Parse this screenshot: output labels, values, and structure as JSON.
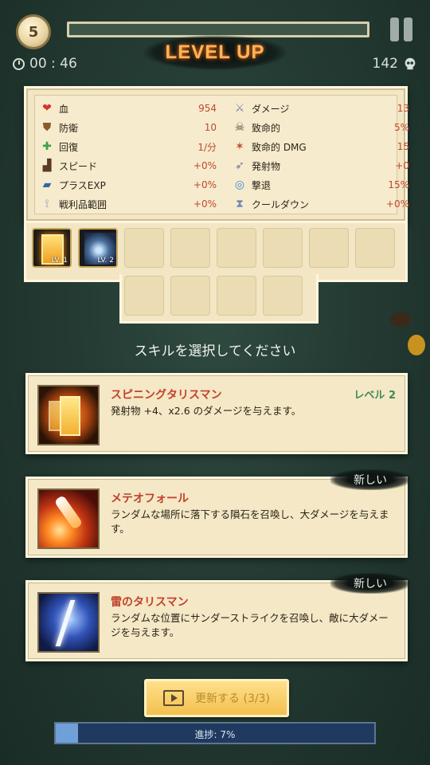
{
  "hud": {
    "level": "5",
    "timer": "00 : 46",
    "kills": "142",
    "title": "LEVEL UP",
    "icons": {
      "clock": "clock-icon",
      "skull": "skull-icon",
      "pause": "pause-icon"
    }
  },
  "stats": {
    "left": [
      {
        "icon": "heart-icon",
        "glyph": "❤",
        "color": "#d2362b",
        "label": "血",
        "value": "954"
      },
      {
        "icon": "shield-icon",
        "glyph": "⛊",
        "color": "#8a5a2b",
        "label": "防衛",
        "value": "10"
      },
      {
        "icon": "heal-cross-icon",
        "glyph": "✚",
        "color": "#3aa24a",
        "label": "回復",
        "value": "1/分"
      },
      {
        "icon": "boot-icon",
        "glyph": "▟",
        "color": "#5a3a22",
        "label": "スピード",
        "value": "+0%"
      },
      {
        "icon": "book-icon",
        "glyph": "▰",
        "color": "#2f6aa8",
        "label": "プラスEXP",
        "value": "+0%"
      },
      {
        "icon": "magnet-icon",
        "glyph": "⟟",
        "color": "#8aa2b8",
        "label": "戦利品範囲",
        "value": "+0%"
      }
    ],
    "right": [
      {
        "icon": "sword-icon",
        "glyph": "⚔",
        "color": "#7a8aa0",
        "label": "ダメージ",
        "value": "13"
      },
      {
        "icon": "crit-skull-icon",
        "glyph": "☠",
        "color": "#4a4a4a",
        "label": "致命的",
        "value": "5%"
      },
      {
        "icon": "crit-damage-icon",
        "glyph": "✶",
        "color": "#c0492e",
        "label": "致命的 DMG",
        "value": "15"
      },
      {
        "icon": "projectile-icon",
        "glyph": "➶",
        "color": "#6a7a98",
        "label": "発射物",
        "value": "+0"
      },
      {
        "icon": "knockback-icon",
        "glyph": "◎",
        "color": "#3a8ad0",
        "label": "撃退",
        "value": "15%"
      },
      {
        "icon": "cooldown-icon",
        "glyph": "⧗",
        "color": "#6a8ab8",
        "label": "クールダウン",
        "value": "+0%"
      }
    ]
  },
  "slots": [
    {
      "icon": "talisman-skill-icon",
      "level": "LV. 1"
    },
    {
      "icon": "blade-skill-icon",
      "level": "LV. 2"
    }
  ],
  "prompt": "スキルを選択してください",
  "cards": [
    {
      "name": "スピニングタリスマン",
      "tag": "レベル 2",
      "desc": "発射物 +4、x2.6 のダメージを与えます。",
      "icon": "spinning-talisman-icon"
    },
    {
      "name": "メテオフォール",
      "badge": "新しい",
      "desc": "ランダムな場所に落下する隕石を召喚し、大ダメージを与えます。",
      "icon": "meteor-icon"
    },
    {
      "name": "雷のタリスマン",
      "badge": "新しい",
      "desc": "ランダムな位置にサンダーストライクを召喚し、敵に大ダメージを与えます。",
      "icon": "thunder-talisman-icon"
    }
  ],
  "refresh": {
    "label": "更新する (3/3)",
    "icon": "video-ad-icon"
  },
  "progress": {
    "label": "進捗: 7%",
    "value": 0.07
  }
}
